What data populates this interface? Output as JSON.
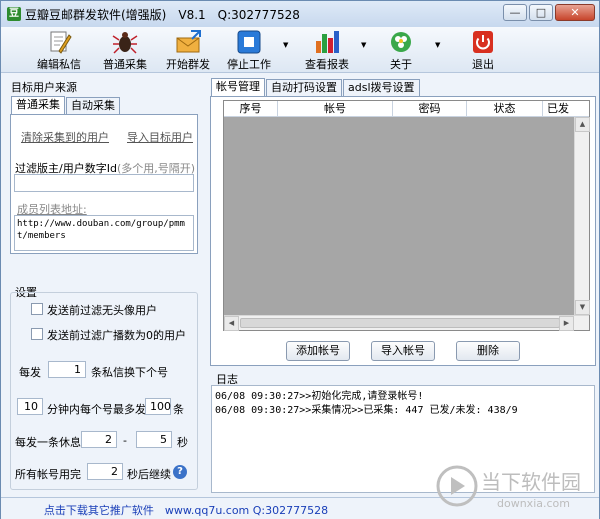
{
  "window": {
    "title": "豆瓣豆邮群发软件(增强版)　V8.1　Q:302777528",
    "app_icon": "豆"
  },
  "window_buttons": {
    "minimize": "—",
    "maximize": "□",
    "close": "✕"
  },
  "toolbar": {
    "items": [
      {
        "label": "编辑私信",
        "icon": "edit-document-icon"
      },
      {
        "label": "普通采集",
        "icon": "bug-icon"
      },
      {
        "label": "开始群发",
        "icon": "envelope-icon"
      },
      {
        "label": "停止工作",
        "icon": "stop-icon"
      },
      {
        "label": "查看报表",
        "icon": "bar-chart-icon"
      },
      {
        "label": "关于",
        "icon": "globe-flower-icon"
      },
      {
        "label": "退出",
        "icon": "power-icon"
      }
    ],
    "dropdown_glyph": "▼"
  },
  "left": {
    "group_title": "目标用户来源",
    "tabs": [
      "普通采集",
      "自动采集"
    ],
    "clear_link": "清除采集到的用户",
    "import_link": "导入目标用户",
    "filter_label": "过滤版主/用户数字Id",
    "filter_hint": "(多个用,号隔开)",
    "filter_value": "",
    "members_link": "成员列表地址:",
    "members_url": "http://www.douban.com/group/pmmt/members",
    "settings_title": "设置",
    "cb1_label": "发送前过滤无头像用户",
    "cb2_label": "发送前过滤广播数为0的用户",
    "per_send_label": "每发",
    "per_send_value": "1",
    "per_send_suffix": "条私信换下个号",
    "per_min_value": "10",
    "per_min_label": "分钟内每个号最多发",
    "per_min_max": "100",
    "per_min_unit": "条",
    "rest_label": "每发一条休息",
    "rest_from": "2",
    "rest_dash": "-",
    "rest_to": "5",
    "rest_unit": "秒",
    "all_used_label": "所有帐号用完",
    "all_used_value": "2",
    "all_used_suffix": "秒后继续",
    "help_glyph": "?"
  },
  "right": {
    "tabs": [
      "帐号管理",
      "自动打码设置",
      "adsl拨号设置"
    ],
    "columns": [
      "序号",
      "帐号",
      "密码",
      "状态",
      "已发"
    ],
    "add_btn": "添加帐号",
    "import_btn": "导入帐号",
    "delete_btn": "删除",
    "log_title": "日志",
    "log_lines": [
      "06/08 09:30:27>>初始化完成,请登录帐号!",
      "06/08 09:30:27>>采集情况>>已采集: 447 已发/未发: 438/9"
    ]
  },
  "statusbar": {
    "text": "点击下载其它推广软件　www.qq7u.com Q:302777528"
  },
  "watermark": {
    "brand": "当下软件园",
    "domain": "downxia.com"
  },
  "scroll_glyphs": {
    "up": "▲",
    "down": "▼",
    "left": "◀",
    "right": "▶"
  }
}
